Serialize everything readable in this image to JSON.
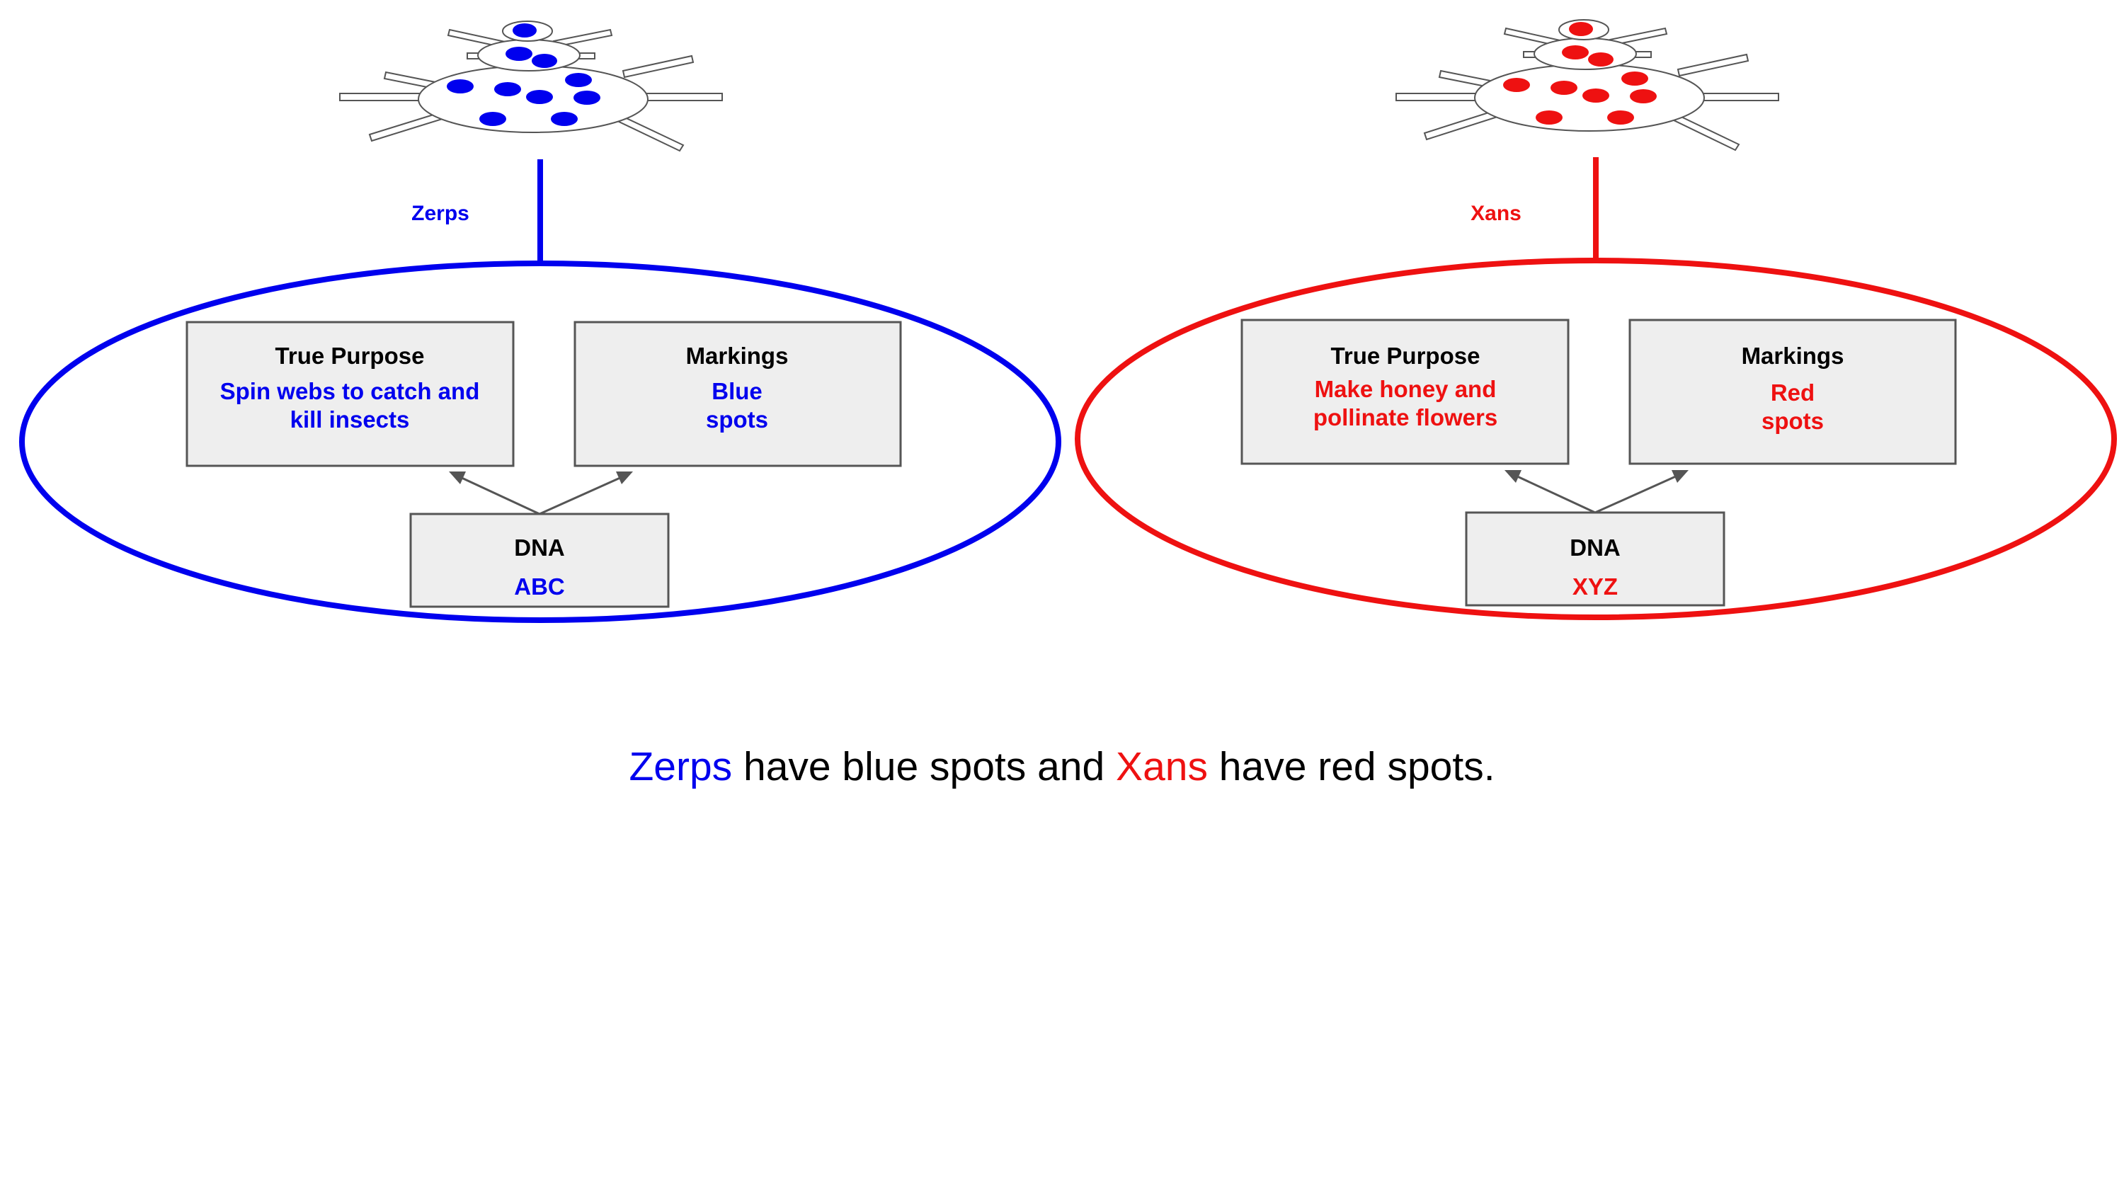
{
  "colors": {
    "zerps": "#0000ee",
    "xans": "#ee1111",
    "box_fill": "#eeeeee",
    "box_stroke": "#555555",
    "arrow": "#555555",
    "text": "#000000"
  },
  "groups": {
    "zerps": {
      "name": "Zerps",
      "purpose_title": "True Purpose",
      "purpose_line1": "Spin webs to catch and",
      "purpose_line2": "kill insects",
      "markings_title": "Markings",
      "markings_line1": "Blue",
      "markings_line2": "spots",
      "dna_title": "DNA",
      "dna_value": "ABC"
    },
    "xans": {
      "name": "Xans",
      "purpose_title": "True Purpose",
      "purpose_line1": "Make honey and",
      "purpose_line2": "pollinate flowers",
      "markings_title": "Markings",
      "markings_line1": "Red",
      "markings_line2": "spots",
      "dna_title": "DNA",
      "dna_value": "XYZ"
    }
  },
  "caption": {
    "part1": "Zerps",
    "part2": " have blue spots and ",
    "part3": "Xans",
    "part4": " have red spots."
  }
}
